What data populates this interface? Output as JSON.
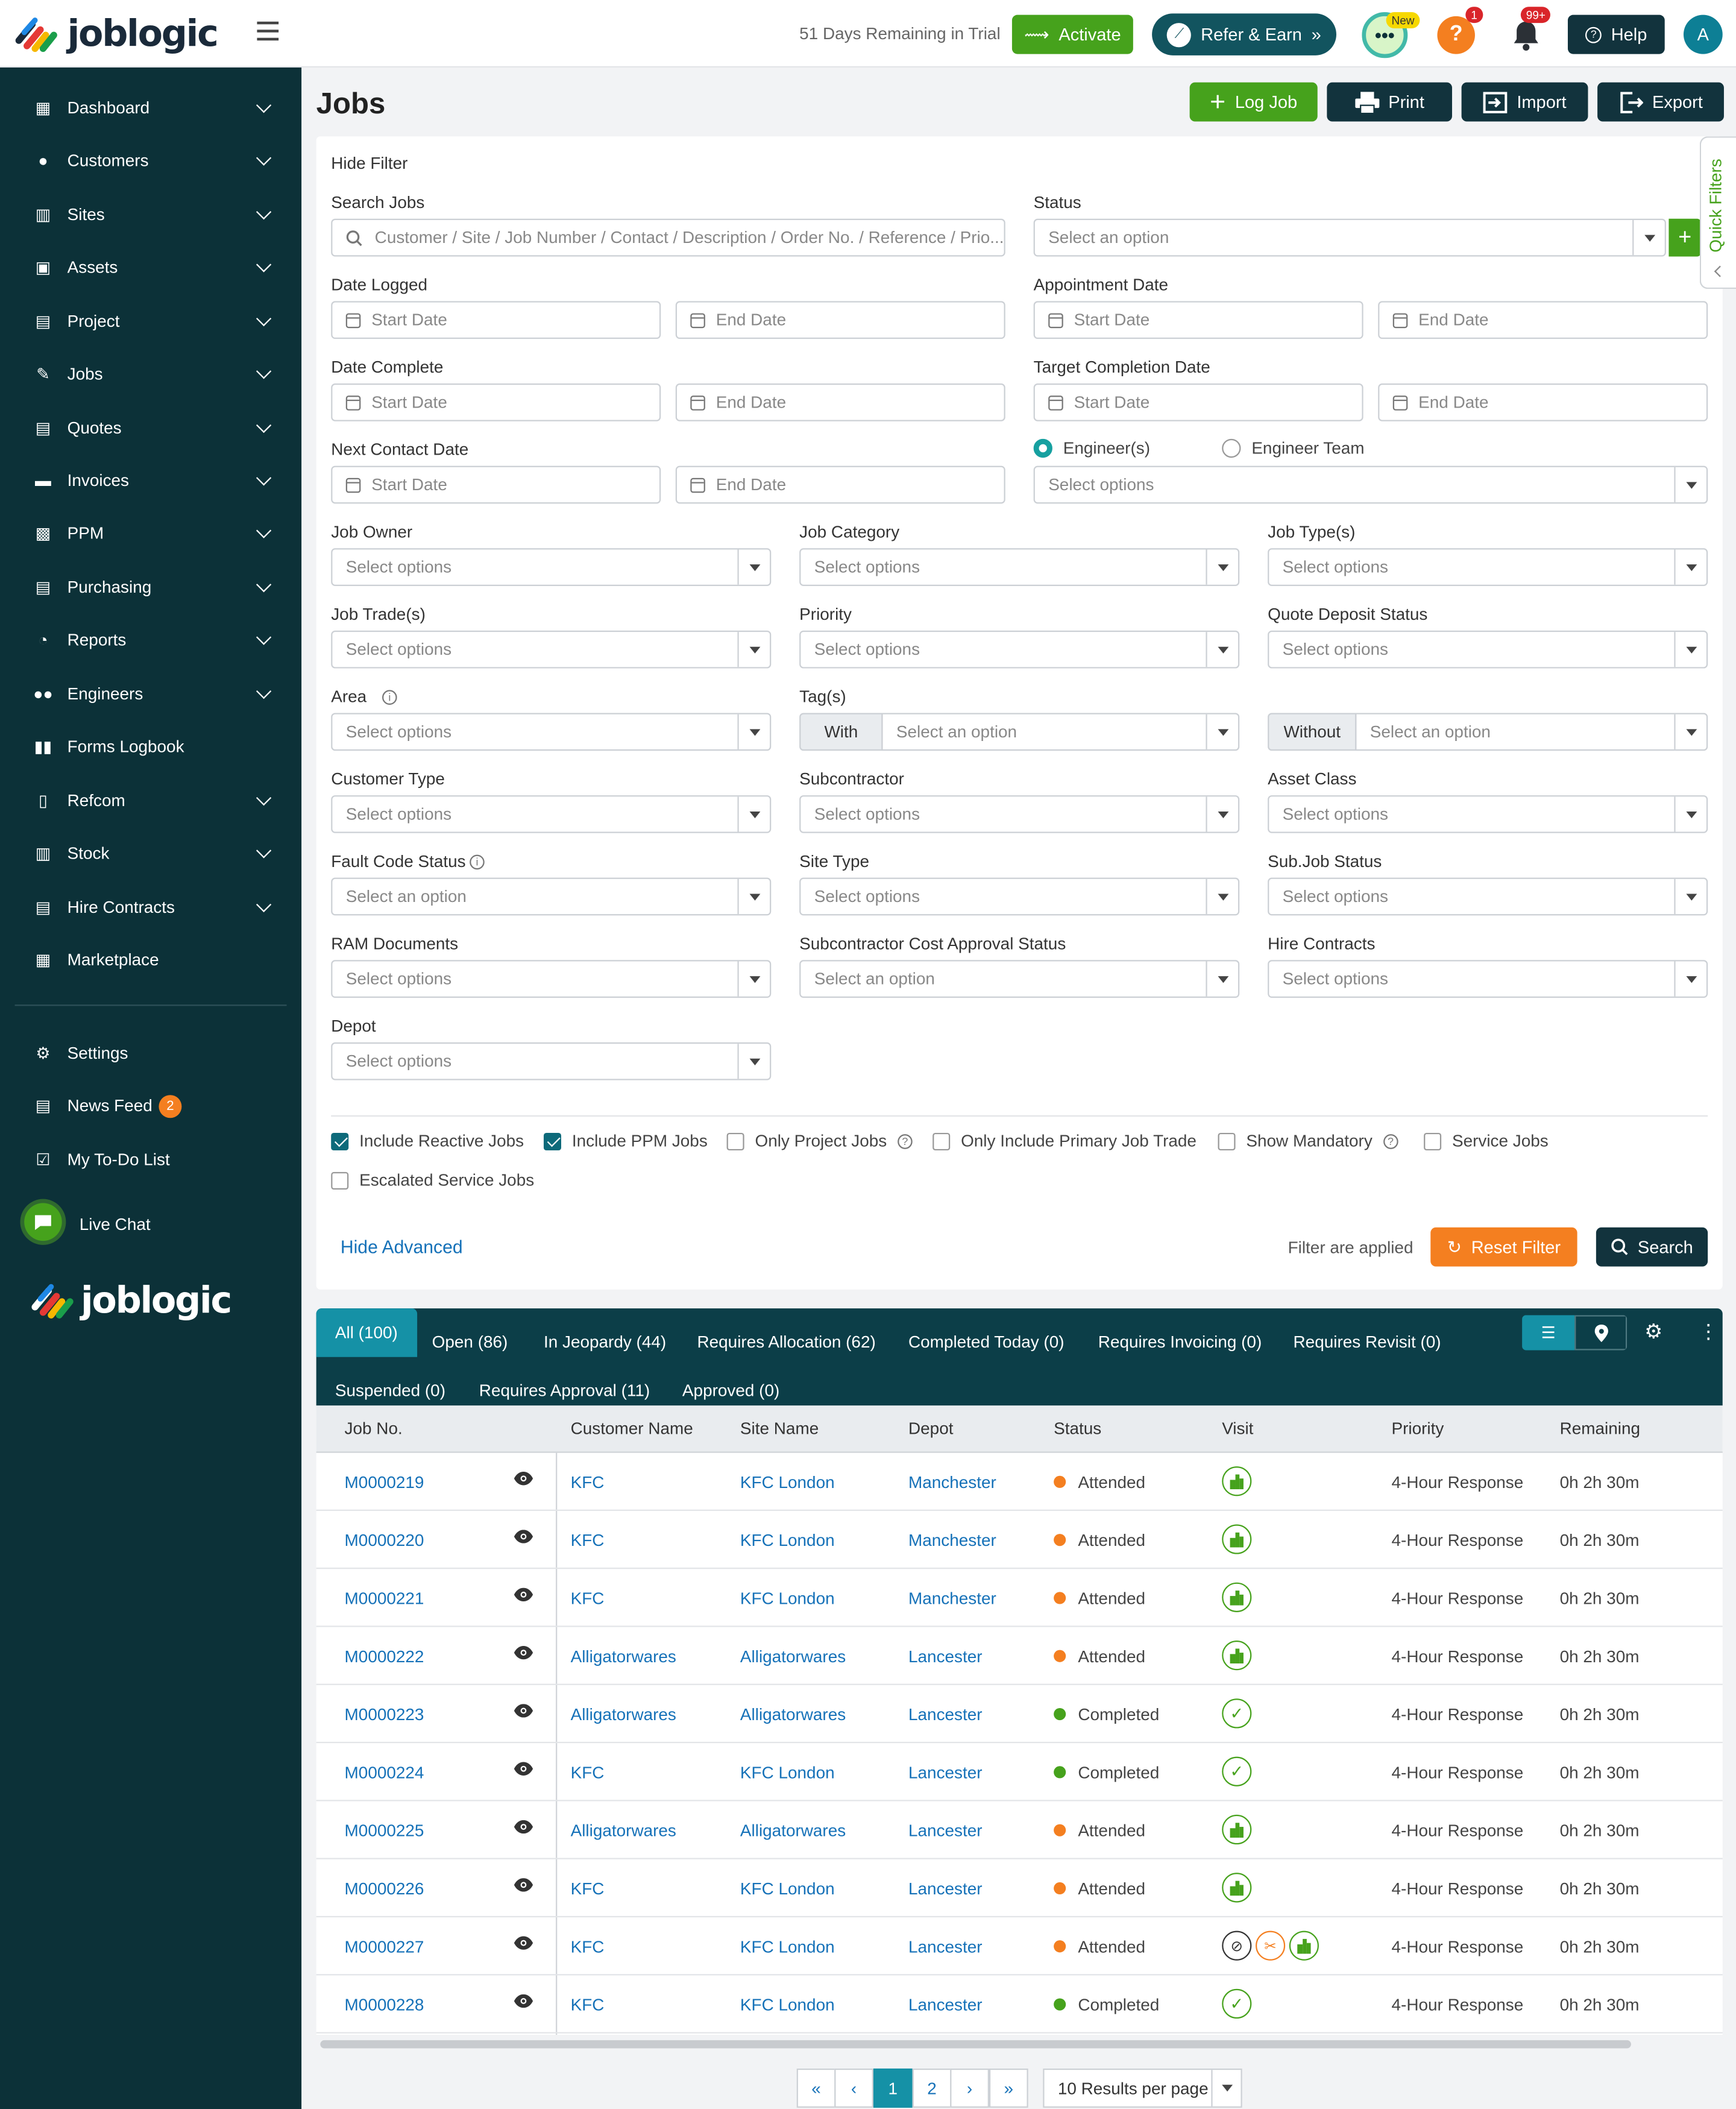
{
  "topbar": {
    "brand": "joblogic",
    "trial": "51 Days Remaining in Trial",
    "activate": "Activate",
    "refer": "Refer & Earn",
    "new_badge": "New",
    "help_badge": "1",
    "notif_badge": "99+",
    "help": "Help",
    "avatar": "A"
  },
  "sidebar": {
    "items": [
      {
        "label": "Dashboard",
        "icon": "dashboard-icon"
      },
      {
        "label": "Customers",
        "icon": "user-icon"
      },
      {
        "label": "Sites",
        "icon": "building-icon"
      },
      {
        "label": "Assets",
        "icon": "asset-icon"
      },
      {
        "label": "Project",
        "icon": "briefcase-icon"
      },
      {
        "label": "Jobs",
        "icon": "wrench-icon"
      },
      {
        "label": "Quotes",
        "icon": "clipboard-icon"
      },
      {
        "label": "Invoices",
        "icon": "invoice-icon"
      },
      {
        "label": "PPM",
        "icon": "calendar-check-icon"
      },
      {
        "label": "Purchasing",
        "icon": "document-icon"
      },
      {
        "label": "Reports",
        "icon": "pie-chart-icon"
      },
      {
        "label": "Engineers",
        "icon": "users-icon"
      },
      {
        "label": "Forms Logbook",
        "icon": "book-icon"
      },
      {
        "label": "Refcom",
        "icon": "cylinder-icon"
      },
      {
        "label": "Stock",
        "icon": "warehouse-icon"
      },
      {
        "label": "Hire Contracts",
        "icon": "contract-icon"
      },
      {
        "label": "Marketplace",
        "icon": "grid-icon"
      }
    ],
    "bottom": [
      {
        "label": "Settings",
        "icon": "user-gear-icon"
      },
      {
        "label": "News Feed",
        "icon": "news-icon",
        "badge": "2"
      },
      {
        "label": "My To-Do List",
        "icon": "todo-icon"
      }
    ],
    "live_chat": "Live Chat",
    "brand": "joblogic"
  },
  "header": {
    "title": "Jobs",
    "log_job": "Log Job",
    "print": "Print",
    "import": "Import",
    "export": "Export"
  },
  "filter": {
    "hide_filter": "Hide Filter",
    "quick_filters": "Quick Filters",
    "search_label": "Search Jobs",
    "search_placeholder": "Customer / Site / Job Number / Contact / Description / Order No. / Reference / Prio...",
    "status_label": "Status",
    "select_option": "Select an option",
    "select_options": "Select options",
    "start": "Start Date",
    "end": "End Date",
    "date_logged": "Date Logged",
    "appointment_date": "Appointment Date",
    "date_complete": "Date Complete",
    "target_completion": "Target Completion Date",
    "next_contact": "Next Contact Date",
    "engineers_radio": "Engineer(s)",
    "engineer_team_radio": "Engineer Team",
    "job_owner": "Job Owner",
    "job_category": "Job Category",
    "job_types": "Job Type(s)",
    "job_trades": "Job Trade(s)",
    "priority": "Priority",
    "quote_deposit": "Quote Deposit Status",
    "area": "Area",
    "tags": "Tag(s)",
    "with": "With",
    "without": "Without",
    "customer_type": "Customer Type",
    "subcontractor": "Subcontractor",
    "asset_class": "Asset Class",
    "fault_code": "Fault Code Status",
    "site_type": "Site Type",
    "subjob_status": "Sub.Job Status",
    "ram_docs": "RAM Documents",
    "sub_cost": "Subcontractor Cost Approval Status",
    "hire_contracts": "Hire Contracts",
    "depot": "Depot",
    "checks": [
      {
        "label": "Include Reactive Jobs",
        "checked": true
      },
      {
        "label": "Include PPM Jobs",
        "checked": true
      },
      {
        "label": "Only Project Jobs",
        "checked": false
      },
      {
        "label": "Only Include Primary Job Trade",
        "checked": false
      },
      {
        "label": "Show Mandatory",
        "checked": false
      },
      {
        "label": "Service Jobs",
        "checked": false
      },
      {
        "label": "Escalated Service Jobs",
        "checked": false
      }
    ],
    "hide_advanced": "Hide Advanced",
    "applied": "Filter are applied",
    "reset": "Reset Filter",
    "search": "Search"
  },
  "tabs": [
    "All (100)",
    "Open (86)",
    "In Jeopardy (44)",
    "Requires Allocation (62)",
    "Completed Today (0)",
    "Requires Invoicing (0)",
    "Requires Revisit (0)",
    "Suspended (0)",
    "Requires Approval (11)",
    "Approved (0)"
  ],
  "table": {
    "columns": [
      "Job No.",
      "Customer Name",
      "Site Name",
      "Depot",
      "Status",
      "Visit",
      "Priority",
      "Remaining"
    ],
    "rows": [
      {
        "job": "M0000219",
        "customer": "KFC",
        "site": "KFC London",
        "depot": "Manchester",
        "status": "Attended",
        "color": "#f47f20",
        "visit": "building",
        "priority": "4-Hour Response",
        "remaining": "0h 2h 30m"
      },
      {
        "job": "M0000220",
        "customer": "KFC",
        "site": "KFC London",
        "depot": "Manchester",
        "status": "Attended",
        "color": "#f47f20",
        "visit": "building",
        "priority": "4-Hour Response",
        "remaining": "0h 2h 30m"
      },
      {
        "job": "M0000221",
        "customer": "KFC",
        "site": "KFC London",
        "depot": "Manchester",
        "status": "Attended",
        "color": "#f47f20",
        "visit": "building",
        "priority": "4-Hour Response",
        "remaining": "0h 2h 30m"
      },
      {
        "job": "M0000222",
        "customer": "Alligatorwares",
        "site": "Alligatorwares",
        "depot": "Lancester",
        "status": "Attended",
        "color": "#f47f20",
        "visit": "building",
        "priority": "4-Hour Response",
        "remaining": "0h 2h 30m"
      },
      {
        "job": "M0000223",
        "customer": "Alligatorwares",
        "site": "Alligatorwares",
        "depot": "Lancester",
        "status": "Completed",
        "color": "#46a21c",
        "visit": "check",
        "priority": "4-Hour Response",
        "remaining": "0h 2h 30m"
      },
      {
        "job": "M0000224",
        "customer": "KFC",
        "site": "KFC London",
        "depot": "Lancester",
        "status": "Completed",
        "color": "#46a21c",
        "visit": "check",
        "priority": "4-Hour Response",
        "remaining": "0h 2h 30m"
      },
      {
        "job": "M0000225",
        "customer": "Alligatorwares",
        "site": "Alligatorwares",
        "depot": "Lancester",
        "status": "Attended",
        "color": "#f47f20",
        "visit": "building",
        "priority": "4-Hour Response",
        "remaining": "0h 2h 30m"
      },
      {
        "job": "M0000226",
        "customer": "KFC",
        "site": "KFC London",
        "depot": "Lancester",
        "status": "Attended",
        "color": "#f47f20",
        "visit": "building",
        "priority": "4-Hour Response",
        "remaining": "0h 2h 30m"
      },
      {
        "job": "M0000227",
        "customer": "KFC",
        "site": "KFC London",
        "depot": "Lancester",
        "status": "Attended",
        "color": "#f47f20",
        "visit": "multi",
        "priority": "4-Hour Response",
        "remaining": "0h 2h 30m"
      },
      {
        "job": "M0000228",
        "customer": "KFC",
        "site": "KFC London",
        "depot": "Lancester",
        "status": "Completed",
        "color": "#46a21c",
        "visit": "check",
        "priority": "4-Hour Response",
        "remaining": "0h 2h 30m"
      }
    ]
  },
  "pagination": {
    "pages": [
      "1",
      "2"
    ],
    "current": "1",
    "per_page": "10 Results per page"
  }
}
